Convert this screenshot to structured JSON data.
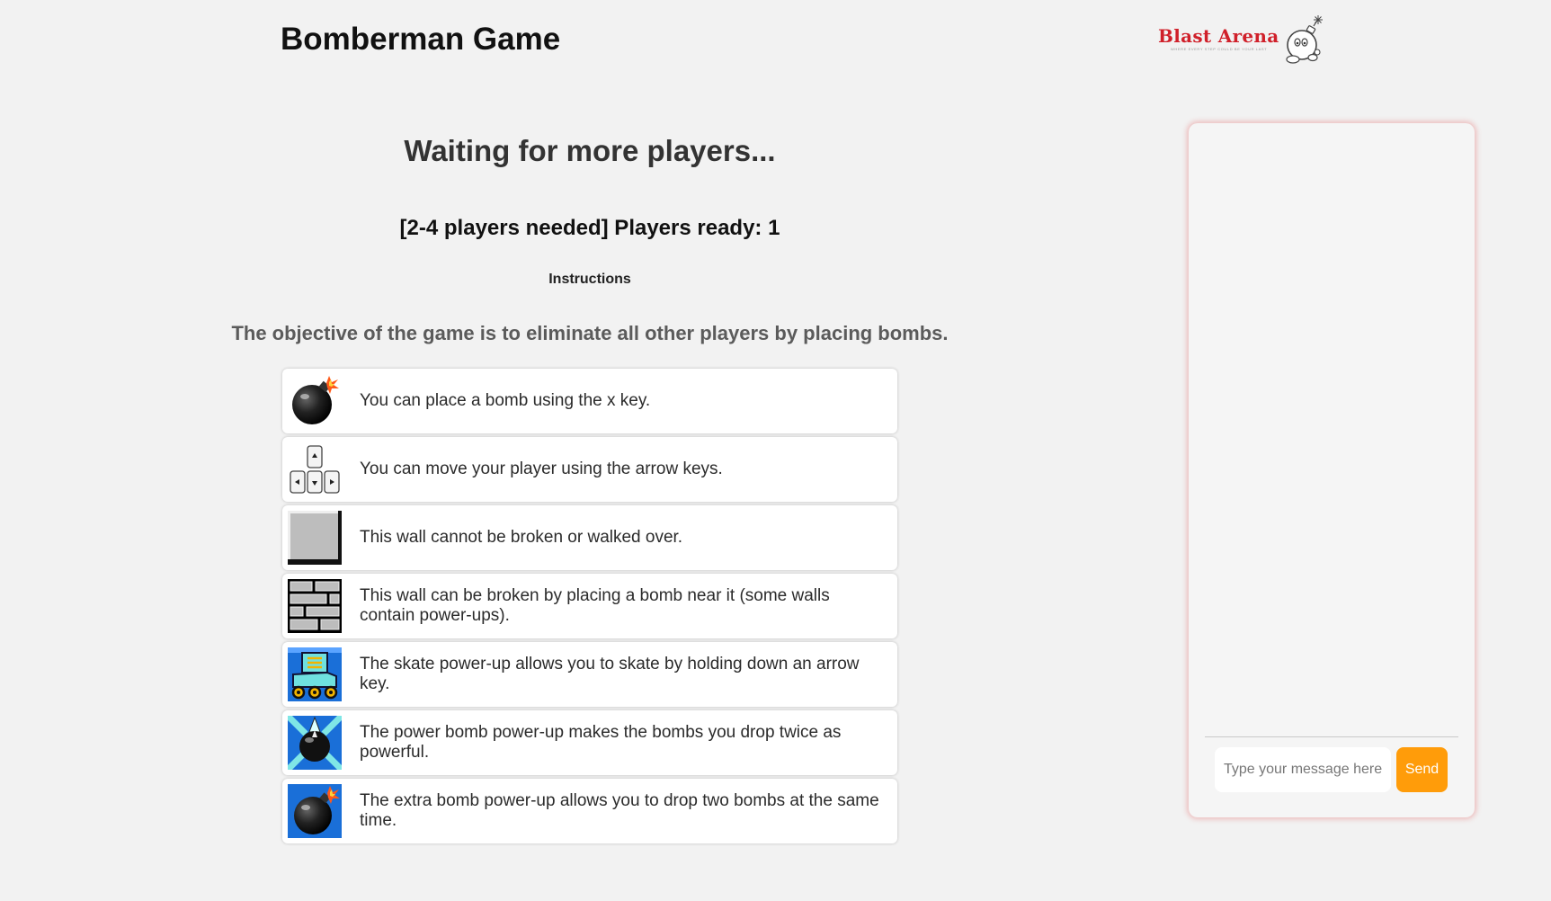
{
  "header": {
    "title": "Bomberman Game",
    "logo": {
      "name": "Blast Arena",
      "tagline": "WHERE EVERY STEP COULD BE YOUR LAST",
      "icon": "bomb-mascot-icon",
      "color": "#d0202a"
    }
  },
  "main": {
    "status": "Waiting for more players...",
    "players_ready": "[2-4 players needed] Players ready: 1",
    "instructions_heading": "Instructions",
    "objective": "The objective of the game is to eliminate all other players by placing bombs.",
    "instructions": [
      {
        "icon": "bomb-icon",
        "text": "You can place a bomb using the x key."
      },
      {
        "icon": "arrow-keys-icon",
        "text": "You can move your player using the arrow keys."
      },
      {
        "icon": "solid-wall-icon",
        "text": "This wall cannot be broken or walked over."
      },
      {
        "icon": "brick-wall-icon",
        "text": "This wall can be broken by placing a bomb near it (some walls contain power-ups)."
      },
      {
        "icon": "skate-powerup-icon",
        "text": "The skate power-up allows you to skate by holding down an arrow key."
      },
      {
        "icon": "power-bomb-powerup-icon",
        "text": "The power bomb power-up makes the bombs you drop twice as powerful."
      },
      {
        "icon": "extra-bomb-powerup-icon",
        "text": "The extra bomb power-up allows you to drop two bombs at the same time."
      }
    ]
  },
  "chat": {
    "placeholder": "Type your message here",
    "send_label": "Send",
    "accent_color": "#ff9c0a"
  }
}
